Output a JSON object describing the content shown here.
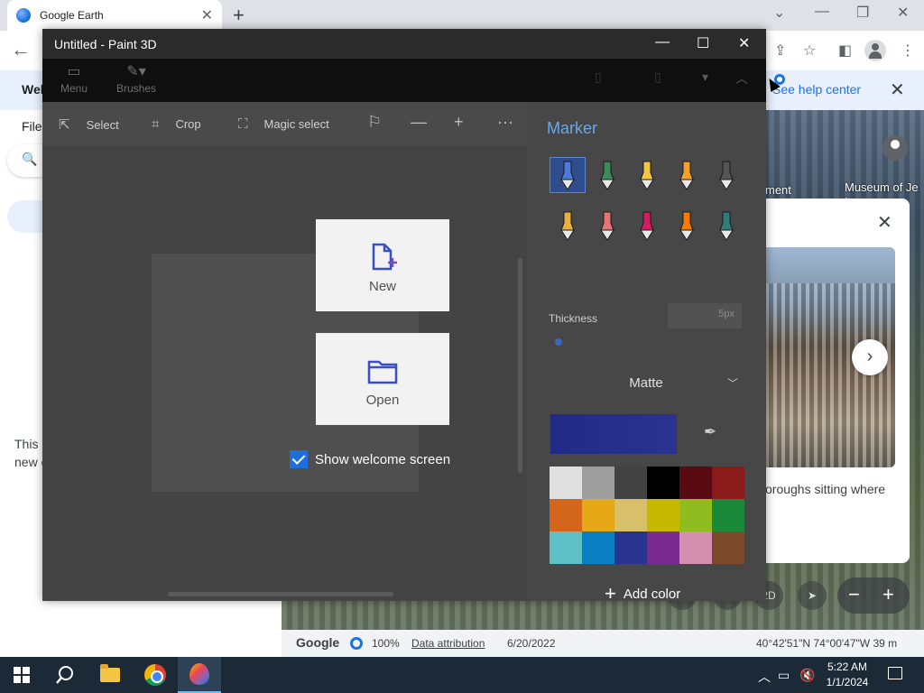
{
  "browser": {
    "tab_title": "Google Earth",
    "tab_close": "✕",
    "new_tab": "+"
  },
  "earth": {
    "banner_welcome": "Wel",
    "help_link": "See help center",
    "menu_file": "File",
    "side_text": "This i new o",
    "label_museum": "Museum of Je\nL",
    "label_ment": "ment",
    "card_caption": "oroughs sitting where",
    "status": {
      "brand": "Google",
      "zoom_pct": "100%",
      "attribution": "Data attribution",
      "date": "6/20/2022",
      "coords": "40°42'51\"N 74°00'47\"W  39 m"
    },
    "view_2d": "2D"
  },
  "paint3d": {
    "window_title": "Untitled - Paint 3D",
    "ribbon": [
      {
        "label": "Menu",
        "icon": "folder-icon"
      },
      {
        "label": "Brushes",
        "icon": "brush-icon"
      }
    ],
    "tools": {
      "select": "Select",
      "crop": "Crop",
      "magic_select": "Magic select"
    },
    "welcome": {
      "new_label": "New",
      "open_label": "Open",
      "show_welcome": "Show welcome screen",
      "show_welcome_checked": true
    },
    "panel": {
      "title": "Marker",
      "thickness_label": "Thickness",
      "thickness_value": "5px",
      "finish": "Matte",
      "current_color": "#2a338f",
      "add_color": "Add color",
      "brushes": [
        {
          "name": "marker",
          "color": "#4a7bd8",
          "selected": true
        },
        {
          "name": "calligraphy-pen",
          "color": "#3d8a5a"
        },
        {
          "name": "oil-brush",
          "color": "#f4c542"
        },
        {
          "name": "watercolor",
          "color": "#f0a030"
        },
        {
          "name": "pixel-pen",
          "color": "#555555"
        },
        {
          "name": "pencil",
          "color": "#e8b040"
        },
        {
          "name": "eraser",
          "color": "#e57373"
        },
        {
          "name": "crayon",
          "color": "#d81b60"
        },
        {
          "name": "spray-can",
          "color": "#f57c00"
        },
        {
          "name": "fill",
          "color": "#2e7d7a"
        }
      ],
      "palette": [
        "#e0e0e0",
        "#9e9e9e",
        "#424242",
        "#000000",
        "#5a0a12",
        "#8b1a1a",
        "#d4661c",
        "#e6a817",
        "#d8c06a",
        "#c7b900",
        "#8fbc1e",
        "#1a8a3a",
        "#5fc1c8",
        "#0a7fc1",
        "#2a338f",
        "#7a2a8f",
        "#d48fae",
        "#7a4a2a"
      ]
    }
  },
  "taskbar": {
    "time": "5:22 AM",
    "date": "1/1/2024"
  }
}
